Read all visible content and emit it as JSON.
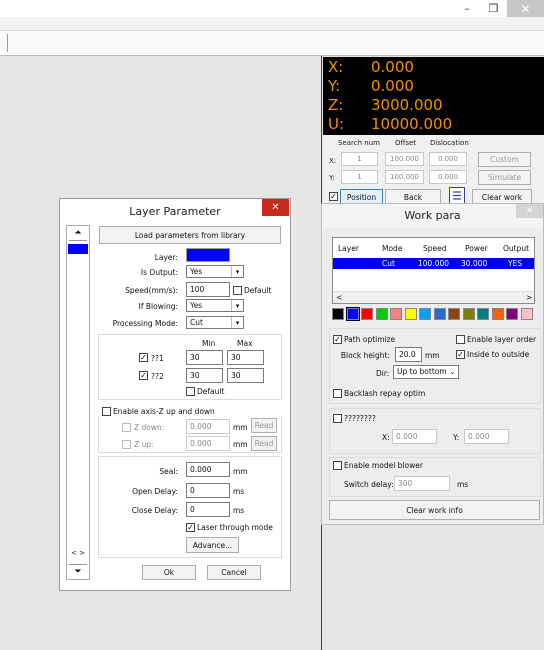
{
  "window": {
    "minimize": "–",
    "restore": "❐",
    "close": "✕"
  },
  "coords": {
    "x_label": "X:",
    "x_value": "0.000",
    "y_label": "Y:",
    "y_value": "0.000",
    "z_label": "Z:",
    "z_value": "3000.000",
    "u_label": "U:",
    "u_value": "10000.000"
  },
  "position_panel": {
    "headers": [
      "Search num",
      "Offset",
      "Dislocation"
    ],
    "x_label": "X:",
    "x_search": "1",
    "x_offset": "100.000",
    "x_dislocation": "0.000",
    "custom_label": "Custom",
    "y_label": "Y:",
    "y_search": "1",
    "y_offset": "100.000",
    "y_dislocation": "0.000",
    "simulate_label": "Simulate",
    "position_label": "Position",
    "back_label": "Back",
    "clear_work_label": "Clear work"
  },
  "work_para": {
    "title": "Work para",
    "columns": [
      "Layer",
      "Mode",
      "Speed",
      "Power",
      "Output"
    ],
    "rows": [
      [
        "",
        "Cut",
        "100.000",
        "30.000",
        "YES"
      ]
    ],
    "palette": [
      "#000000",
      "#0000ff",
      "#ff0000",
      "#00cc00",
      "#ff8080",
      "#ffff00",
      "#00a0ff",
      "#2a6acc",
      "#8b4513",
      "#808000",
      "#008080",
      "#ff6000",
      "#800080",
      "#ffc0cb"
    ],
    "path_optimize": "Path optimize",
    "enable_layer_order": "Enable layer order",
    "block_height_label": "Block height:",
    "block_height": "20.0",
    "block_height_unit": "mm",
    "inside_to_outside": "Inside to outside",
    "dir_label": "Dir:",
    "dir_value": "Up to bottom",
    "backlash": "Backlash repay optim",
    "unknown_option": "????????",
    "x_label": "X:",
    "x_value": "0.000",
    "y_label": "Y:",
    "y_value": "0.000",
    "model_blower": "Enable model blower",
    "switch_delay_label": "Switch delay:",
    "switch_delay": "300",
    "switch_delay_unit": "ms",
    "clear_work_info": "Clear work info"
  },
  "layer_param": {
    "title": "Layer Parameter",
    "load_label": "Load parameters from library",
    "layer_label": "Layer:",
    "layer_color": "#0000ff",
    "is_output_label": "Is Output:",
    "is_output": "Yes",
    "speed_label": "Speed(mm/s):",
    "speed": "100",
    "default_label": "Default",
    "if_blowing_label": "If Blowing:",
    "if_blowing": "Yes",
    "mode_label": "Processing Mode:",
    "mode": "Cut",
    "min_label": "Min",
    "max_label": "Max",
    "power1_label": "??1",
    "power1_min": "30",
    "power1_max": "30",
    "power2_label": "??2",
    "power2_min": "30",
    "power2_max": "30",
    "power_default": "Default",
    "axis_z_label": "Enable axis-Z up and down",
    "z_down_label": "Z down:",
    "z_down": "0.000",
    "z_down_unit": "mm",
    "z_down_read": "Read",
    "z_up_label": "Z up:",
    "z_up": "0.000",
    "z_up_unit": "mm",
    "z_up_read": "Read",
    "seal_label": "Seal:",
    "seal": "0.000",
    "seal_unit": "mm",
    "open_delay_label": "Open Delay:",
    "open_delay": "0",
    "open_delay_unit": "ms",
    "close_delay_label": "Close Delay:",
    "close_delay": "0",
    "close_delay_unit": "ms",
    "laser_through_label": "Laser through mode",
    "advance_label": "Advance...",
    "ok_label": "Ok",
    "cancel_label": "Cancel",
    "nav_left_right": "< >"
  }
}
